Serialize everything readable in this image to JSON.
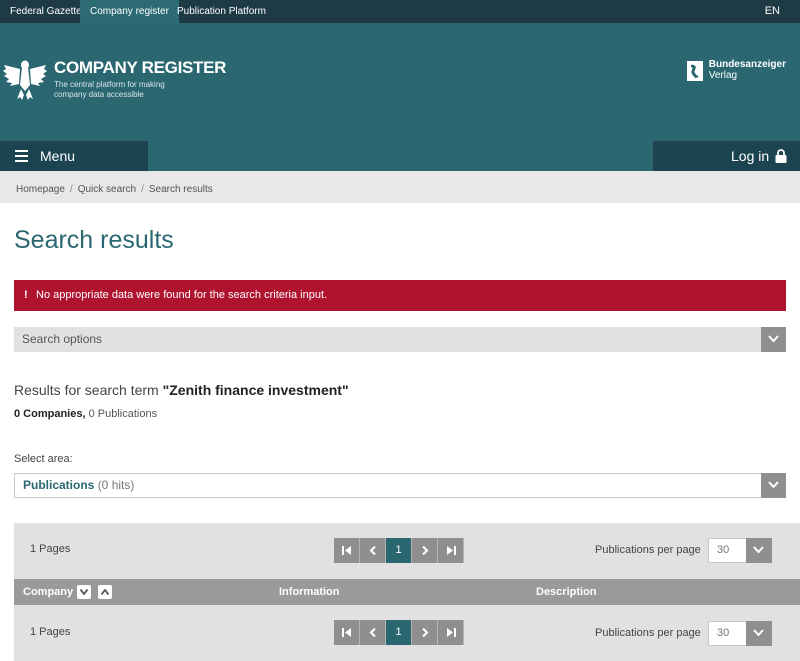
{
  "topnav": {
    "tabs": [
      "Federal Gazette",
      "Company register",
      "Publication Platform"
    ],
    "active_index": 1,
    "lang": "EN"
  },
  "header": {
    "title": "COMPANY REGISTER",
    "subtitle": "The central platform for making company data accessible",
    "publisher_name": "Bundesanzeiger",
    "publisher_sub": "Verlag",
    "menu_label": "Menu",
    "login_label": "Log in"
  },
  "breadcrumb": [
    "Homepage",
    "Quick search",
    "Search results"
  ],
  "page_title": "Search results",
  "alert": {
    "symbol": "!",
    "message": "No appropriate data were found for the search criteria input."
  },
  "search_options": {
    "label": "Search options"
  },
  "results": {
    "prefix": "Results for search term",
    "term": "\"Zenith finance investment\"",
    "companies": "0 Companies,",
    "publications": "0 Publications"
  },
  "area": {
    "label": "Select area:",
    "selected": "Publications",
    "hits": "(0 hits)"
  },
  "table": {
    "pages_label": "1 Pages",
    "current_page": "1",
    "per_page_label": "Publications per page",
    "per_page_value": "30",
    "columns": [
      "Company",
      "Information",
      "Description"
    ]
  },
  "colors": {
    "brand_teal": "#2a6771",
    "nav_dark": "#1d3a45",
    "alert_red": "#b0132e"
  }
}
